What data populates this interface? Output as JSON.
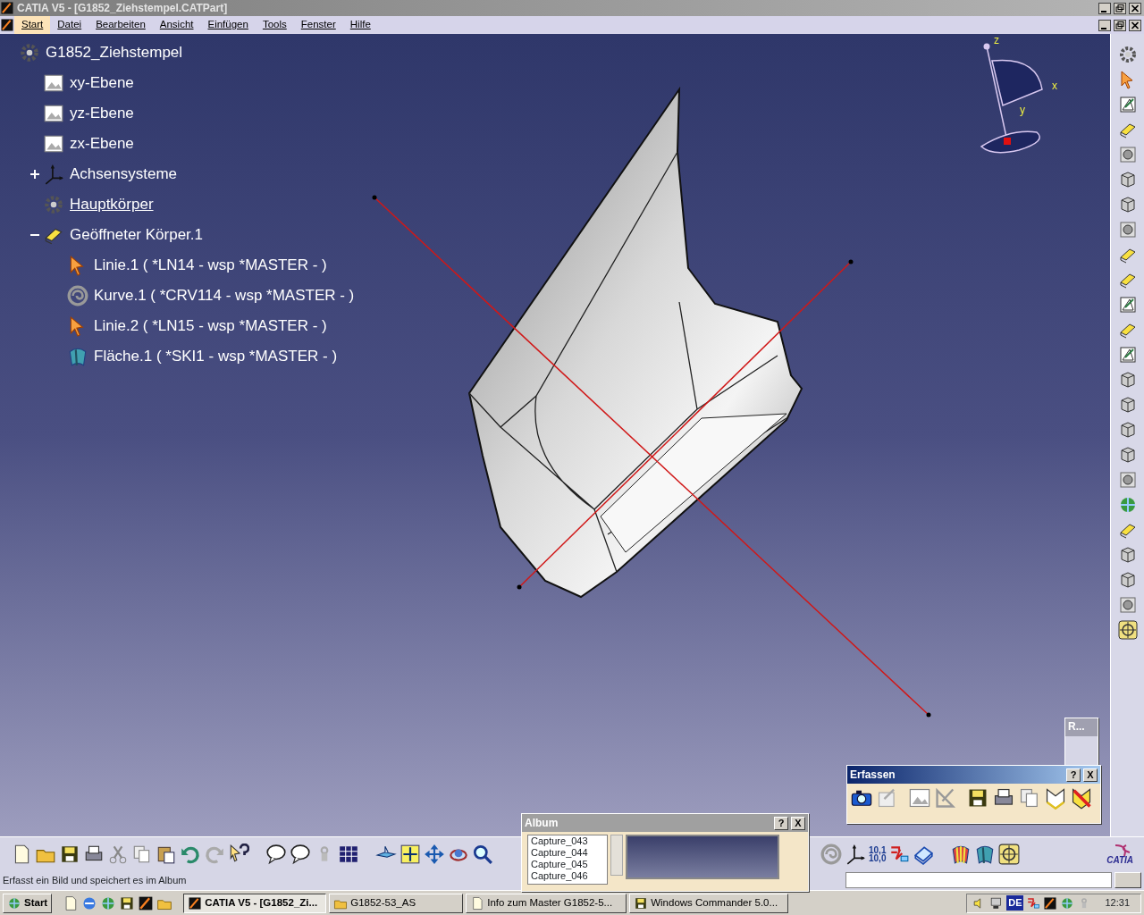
{
  "window": {
    "title": "CATIA V5 - [G1852_Ziehstempel.CATPart]"
  },
  "menu": [
    {
      "label": "Start",
      "selected": true
    },
    {
      "label": "Datei",
      "selected": false
    },
    {
      "label": "Bearbeiten",
      "selected": false
    },
    {
      "label": "Ansicht",
      "selected": false
    },
    {
      "label": "Einfügen",
      "selected": false
    },
    {
      "label": "Tools",
      "selected": false
    },
    {
      "label": "Fenster",
      "selected": false
    },
    {
      "label": "Hilfe",
      "selected": false
    }
  ],
  "tree": {
    "label": "G1852_Ziehstempel",
    "kind": "part",
    "children": [
      {
        "label": "xy-Ebene",
        "kind": "plane",
        "in_work": false
      },
      {
        "label": "yz-Ebene",
        "kind": "plane",
        "in_work": false
      },
      {
        "label": "zx-Ebene",
        "kind": "plane",
        "in_work": false
      },
      {
        "label": "Achsensysteme",
        "kind": "axis",
        "in_work": false,
        "expanded": false
      },
      {
        "label": "Hauptkörper",
        "kind": "body",
        "in_work": true
      },
      {
        "label": "Geöffneter Körper.1",
        "kind": "open-body",
        "in_work": false,
        "expanded": true,
        "children": [
          {
            "label": "Linie.1 ( *LN14 - wsp *MASTER -  )",
            "kind": "line",
            "in_work": false
          },
          {
            "label": "Kurve.1 ( *CRV114 - wsp *MASTER -  )",
            "kind": "curve",
            "in_work": false
          },
          {
            "label": "Linie.2 ( *LN15 - wsp *MASTER -  )",
            "kind": "line",
            "in_work": false
          },
          {
            "label": "Fläche.1 ( *SKI1 - wsp *MASTER -  )",
            "kind": "surface",
            "in_work": false
          }
        ]
      }
    ]
  },
  "compass": {
    "labels": [
      "z",
      "x",
      "y"
    ]
  },
  "ruler_window": {
    "title": "R..."
  },
  "capture_toolbar": {
    "title": "Erfassen",
    "buttons": [
      "?",
      "X"
    ]
  },
  "album": {
    "title": "Album",
    "buttons": [
      "?",
      "X"
    ],
    "items": [
      "Capture_043",
      "Capture_044",
      "Capture_045",
      "Capture_046"
    ]
  },
  "units_icon": [
    "10,1",
    "10,0"
  ],
  "logo_text": "CATIA",
  "status_bar": {
    "text": "Erfasst ein Bild und speichert es im Album"
  },
  "taskbar": {
    "start": "Start",
    "tasks": [
      {
        "label": "CATIA V5 - [G1852_Zi...",
        "selected": true
      },
      {
        "label": "G1852-53_AS",
        "selected": false
      },
      {
        "label": "Info zum Master G1852-5...",
        "selected": false
      },
      {
        "label": "Windows Commander 5.0...",
        "selected": false
      }
    ],
    "language": "DE",
    "clock": "12:31"
  }
}
